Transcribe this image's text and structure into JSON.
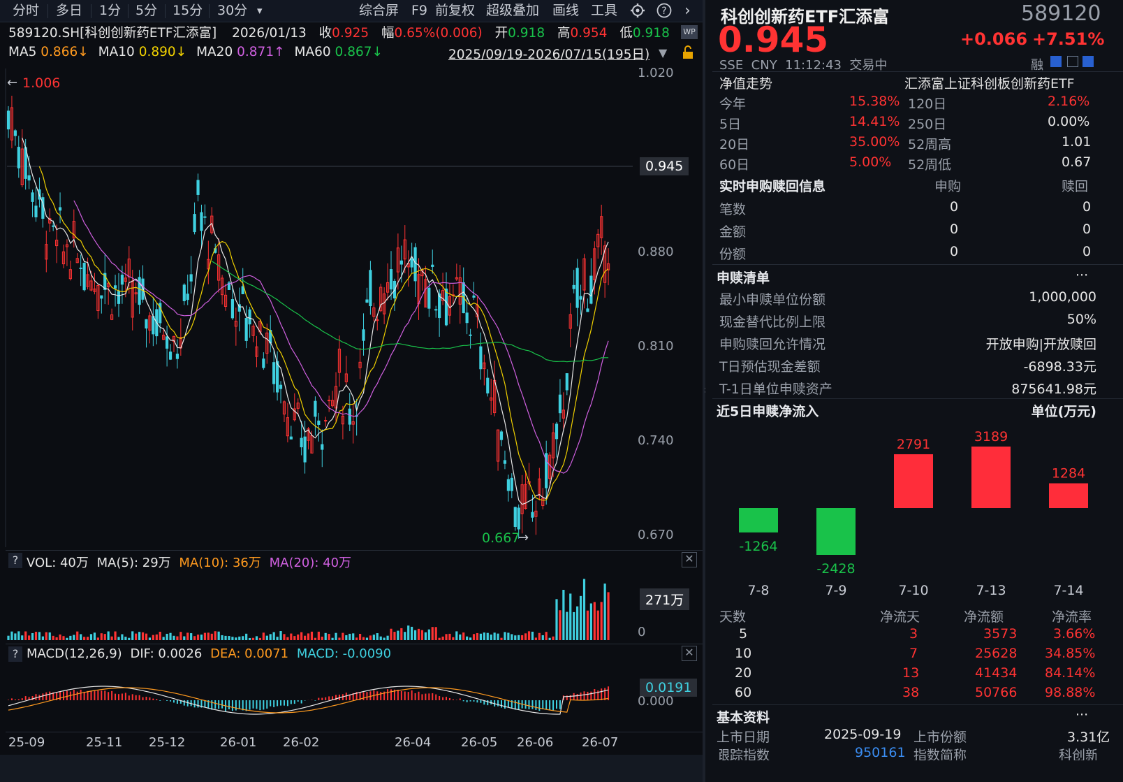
{
  "toolbar": {
    "left_items": [
      "分时",
      "多日",
      "1分",
      "5分",
      "15分",
      "30分"
    ],
    "dropdown_glyph": "▾",
    "right_items": [
      "综合屏",
      "F9",
      "前复权",
      "超级叠加",
      "画线",
      "工具"
    ],
    "arrow": "›"
  },
  "quote_line": {
    "code": "589120.SH[科创创新药ETF汇添富]",
    "date": "2026/01/13",
    "close_label": "收",
    "close": "0.925",
    "amp_label": "幅",
    "amp": "0.65%(0.006)",
    "open_label": "开",
    "open": "0.918",
    "high_label": "高",
    "high": "0.954",
    "low_label": "低",
    "low": "0.918"
  },
  "ma_line": {
    "ma5_label": "MA5",
    "ma5": "0.866↓",
    "ma10_label": "MA10",
    "ma10": "0.890↓",
    "ma20_label": "MA20",
    "ma20": "0.871↑",
    "ma60_label": "MA60",
    "ma60": "0.867↓",
    "range": "2025/09/19-2026/07/15(195日)"
  },
  "main_chart": {
    "y_ticks": [
      "1.020",
      "0.880",
      "0.810",
      "0.740",
      "0.670"
    ],
    "max_marker": "1.006",
    "min_marker": "0.667",
    "current_price_tag": "0.945",
    "x_ticks": [
      "25-09",
      "25-11",
      "25-12",
      "26-01",
      "26-02",
      "26-04",
      "26-05",
      "26-06",
      "26-07"
    ]
  },
  "vol_panel": {
    "q": "?",
    "vol": "VOL: 40万",
    "ma5": "MA(5): 29万",
    "ma10": "MA(10): 36万",
    "ma20": "MA(20): 40万",
    "tag": "271万",
    "zero": "0"
  },
  "macd_panel": {
    "q": "?",
    "title": "MACD(12,26,9)",
    "dif": "DIF: 0.0026",
    "dea": "DEA: 0.0071",
    "macd": "MACD: -0.0090",
    "tag": "0.0191",
    "zero": "0.000"
  },
  "colors": {
    "up": "#ff3333",
    "down": "#19c24a",
    "candle_down": "#3fd0e0",
    "ma5": "#e8e8e8",
    "ma10": "#f0d000",
    "ma20": "#d060e0",
    "ma60": "#19c24a"
  },
  "right_panel": {
    "name": "科创创新药ETF汇添富",
    "code": "589120",
    "price": "0.945",
    "change": "+0.066",
    "change_pct": "+7.51%",
    "meta": "SSE  CNY  11:12:43  交易中",
    "rong": "融",
    "nav_title": "净值走势",
    "nav_index": "汇添富上证科创板创新药ETF",
    "perf": [
      {
        "l1": "今年",
        "v1": "15.38%",
        "l2": "120日",
        "v2": "2.16%"
      },
      {
        "l1": "5日",
        "v1": "14.41%",
        "l2": "250日",
        "v2": "0.00%"
      },
      {
        "l1": "20日",
        "v1": "35.00%",
        "l2": "52周高",
        "v2": "1.01"
      },
      {
        "l1": "60日",
        "v1": "5.00%",
        "l2": "52周低",
        "v2": "0.67"
      }
    ],
    "realtime": {
      "title": "实时申购赎回信息",
      "col1": "申购",
      "col2": "赎回",
      "rows": [
        {
          "l": "笔数",
          "a": "0",
          "b": "0"
        },
        {
          "l": "金额",
          "a": "0",
          "b": "0"
        },
        {
          "l": "份额",
          "a": "0",
          "b": "0"
        }
      ]
    },
    "list": {
      "title": "申赎清单",
      "more": "···",
      "rows": [
        {
          "l": "最小申赎单位份额",
          "v": "1,000,000"
        },
        {
          "l": "现金替代比例上限",
          "v": "50%"
        },
        {
          "l": "申购赎回允许情况",
          "v": "开放申购|开放赎回"
        },
        {
          "l": "T日预估现金差额",
          "v": "-6898.33元"
        },
        {
          "l": "T-1日单位申赎资产",
          "v": "875641.98元"
        }
      ]
    },
    "flow": {
      "title": "近5日申赎净流入",
      "unit": "单位(万元)",
      "bars": [
        {
          "date": "7-8",
          "value": -1264,
          "label": "-1264"
        },
        {
          "date": "7-9",
          "value": -2428,
          "label": "-2428"
        },
        {
          "date": "7-10",
          "value": 2791,
          "label": "2791"
        },
        {
          "date": "7-13",
          "value": 3189,
          "label": "3189"
        },
        {
          "date": "7-14",
          "value": 1284,
          "label": "1284"
        }
      ]
    },
    "stats": {
      "headers": [
        "天数",
        "净流天",
        "净流额",
        "净流率"
      ],
      "rows": [
        {
          "d": "5",
          "n": "3",
          "a": "3573",
          "r": "3.66%"
        },
        {
          "d": "10",
          "n": "7",
          "a": "25628",
          "r": "34.85%"
        },
        {
          "d": "20",
          "n": "13",
          "a": "41434",
          "r": "84.14%"
        },
        {
          "d": "60",
          "n": "38",
          "a": "50766",
          "r": "98.88%"
        }
      ]
    },
    "basic": {
      "title": "基本资料",
      "more": "···",
      "r1l": "上市日期",
      "r1v": "2025-09-19",
      "r1l2": "上市份额",
      "r1v2": "3.31亿",
      "r2l": "跟踪指数",
      "r2v": "950161",
      "r2l2": "指数简称",
      "r2v2": "科创新药"
    }
  }
}
